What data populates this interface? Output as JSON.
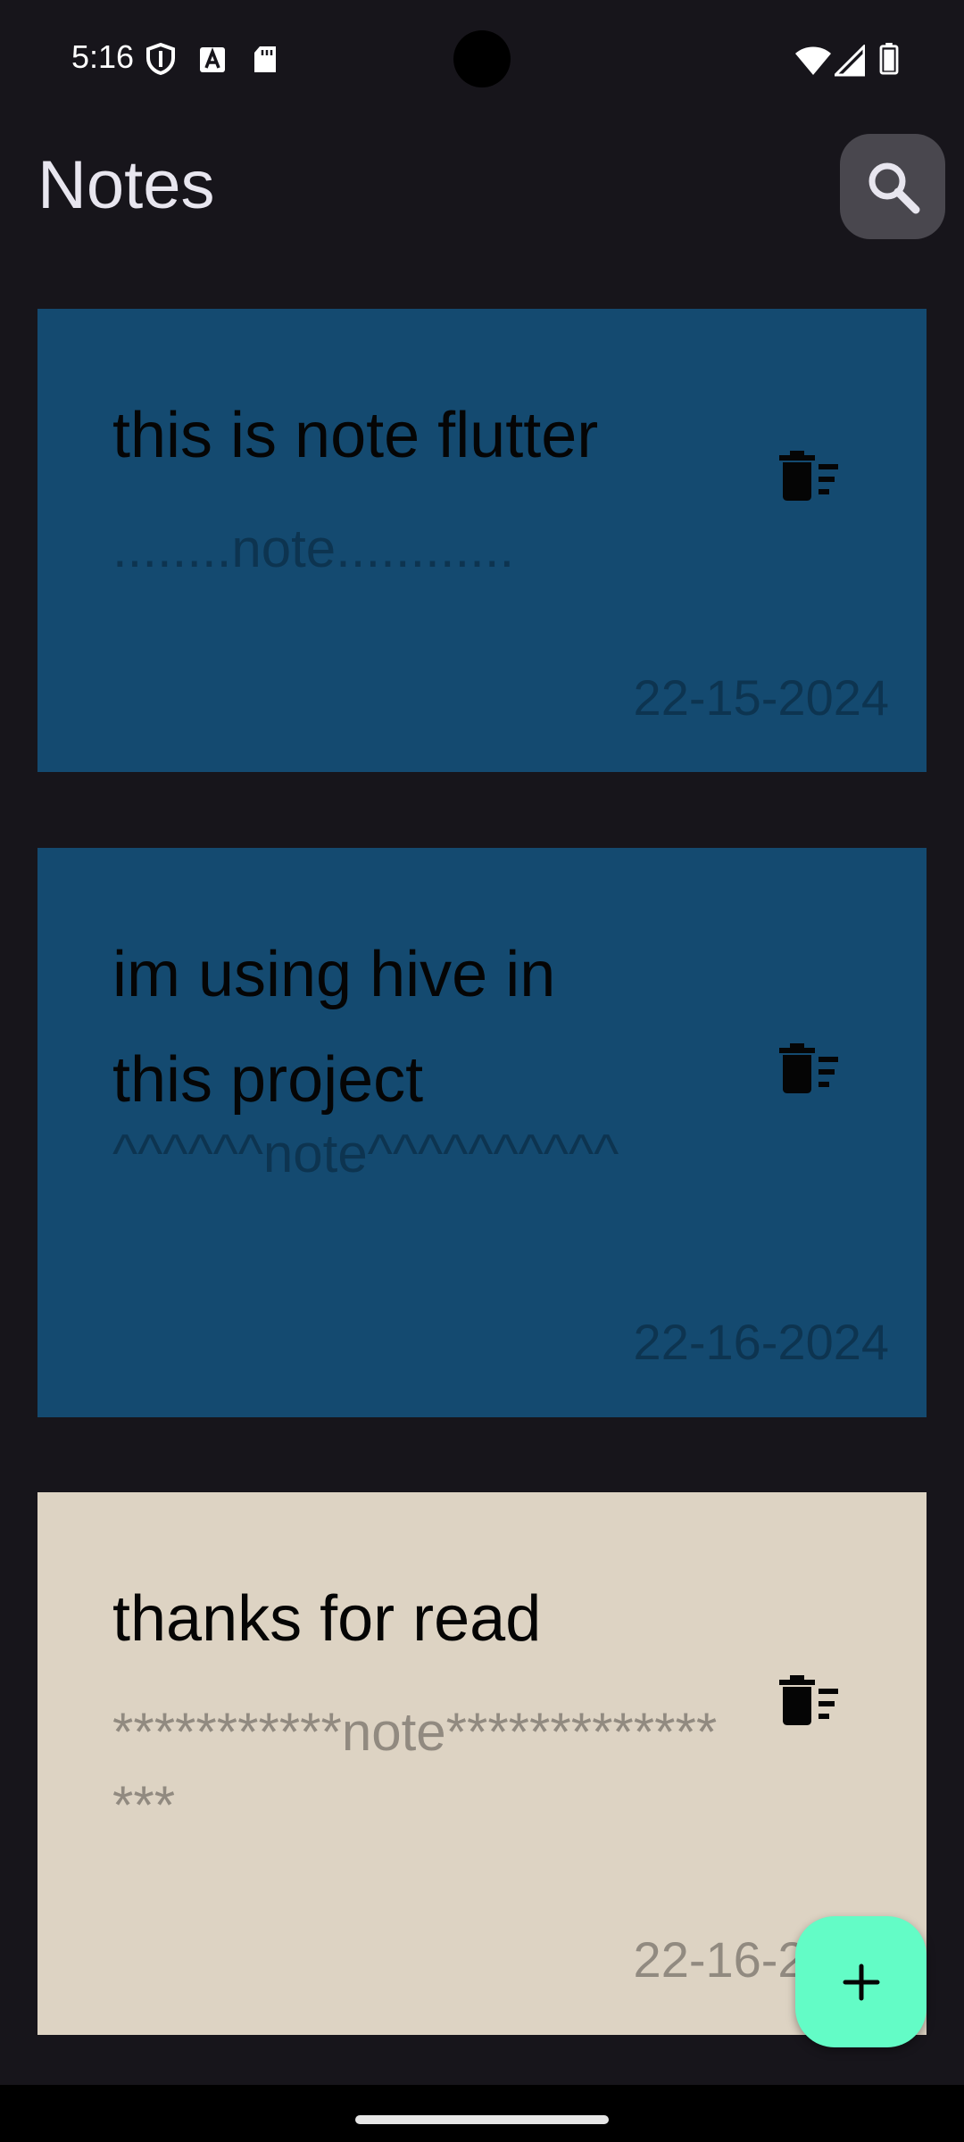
{
  "status_bar": {
    "time": "5:16",
    "left_icons": [
      "shield-icon",
      "a-badge-icon",
      "sd-card-icon"
    ],
    "right_icons": [
      "wifi-icon",
      "signal-icon",
      "battery-icon"
    ]
  },
  "app_bar": {
    "title": "Notes",
    "search_icon": "search-icon"
  },
  "notes": [
    {
      "title": "this is note flutter",
      "content": "........note............",
      "date": "22-15-2024",
      "color": "#144a70"
    },
    {
      "title": "im using hive in this project",
      "content": "^^^^^^note^^^^^^^^^^",
      "date": "22-16-2024",
      "color": "#144a70"
    },
    {
      "title": "thanks for read",
      "content": "***********note****************",
      "date": "22-16-2024",
      "color": "#ddd3c3"
    }
  ],
  "delete_icon": "delete-sweep-icon",
  "fab": {
    "icon": "add-icon"
  },
  "colors": {
    "background": "#17151b",
    "card_blue": "#144a70",
    "card_beige": "#ddd3c3",
    "fab": "#63fcc6",
    "search_button": "#49474e"
  }
}
